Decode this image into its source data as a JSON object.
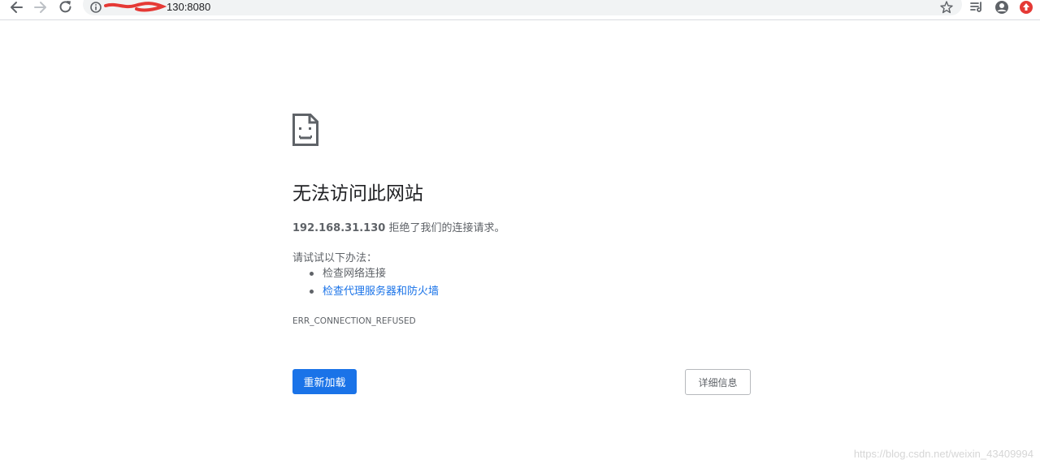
{
  "toolbar": {
    "url_suffix": "130:8080",
    "icons": [
      "back-icon",
      "forward-icon",
      "reload-icon",
      "info-icon",
      "star-icon",
      "reading-list-icon",
      "profile-icon",
      "extension-icon"
    ]
  },
  "error_page": {
    "heading": "无法访问此网站",
    "host": "192.168.31.130",
    "summary_rest": " 拒绝了我们的连接请求。",
    "try_label": "请试试以下办法：",
    "suggestions": [
      "检查网络连接",
      "检查代理服务器和防火墙"
    ],
    "error_code": "ERR_CONNECTION_REFUSED",
    "reload_label": "重新加载",
    "details_label": "详细信息"
  },
  "watermark": "https://blog.csdn.net/weixin_43409994",
  "colors": {
    "accent": "#1a73e8",
    "text_secondary": "#5f6368",
    "redaction": "#e53935"
  }
}
